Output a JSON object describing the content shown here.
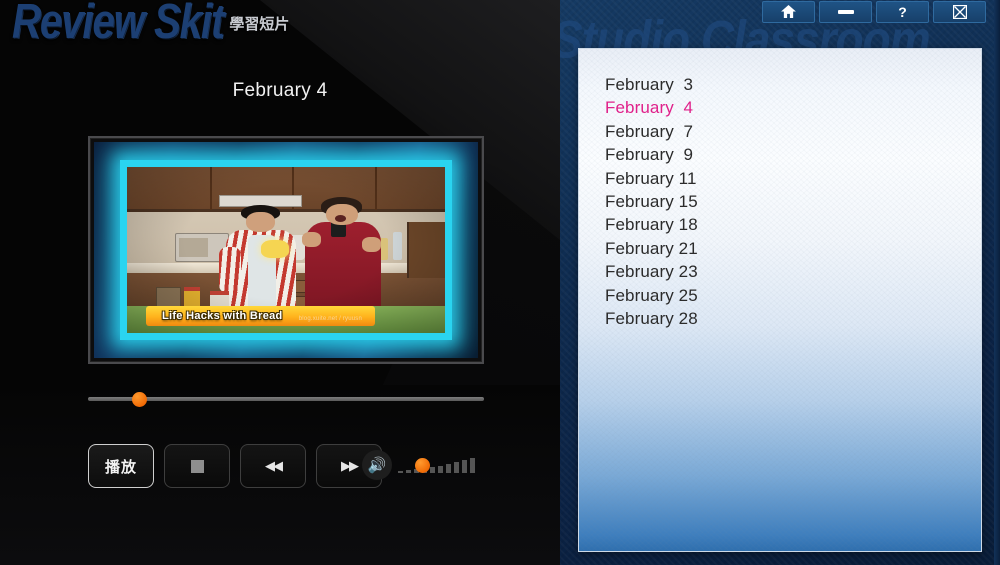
{
  "app": {
    "brand_main": "Review Skit",
    "brand_sub": "學習短片",
    "watermark": "Studio Classroom"
  },
  "titlebar": {
    "buttons": [
      {
        "name": "home",
        "glyph": "⌂",
        "label": "Home"
      },
      {
        "name": "minimize",
        "glyph": "—",
        "label": "Minimize"
      },
      {
        "name": "help",
        "glyph": "?",
        "label": "Help"
      },
      {
        "name": "close",
        "glyph": "☒",
        "label": "Close"
      }
    ]
  },
  "player": {
    "current_date": "February  4",
    "video_title": "Life Hacks with Bread",
    "video_watermark": "blog.xuite.net / ryuusn",
    "progress_percent": 13,
    "volume_percent": 18,
    "controls": [
      {
        "name": "play",
        "label": "播放",
        "icon": "",
        "active": true
      },
      {
        "name": "stop",
        "label": "",
        "icon": "stop-square",
        "active": false
      },
      {
        "name": "rewind",
        "label": "",
        "icon": "◀◀",
        "active": false
      },
      {
        "name": "forward",
        "label": "",
        "icon": "▶▶",
        "active": false
      }
    ],
    "volume_icon": "🔊"
  },
  "date_list": {
    "items": [
      {
        "label": "February  3",
        "selected": false
      },
      {
        "label": "February  4",
        "selected": true
      },
      {
        "label": "February  7",
        "selected": false
      },
      {
        "label": "February  9",
        "selected": false
      },
      {
        "label": "February 11",
        "selected": false
      },
      {
        "label": "February 15",
        "selected": false
      },
      {
        "label": "February 18",
        "selected": false
      },
      {
        "label": "February 21",
        "selected": false
      },
      {
        "label": "February 23",
        "selected": false
      },
      {
        "label": "February 25",
        "selected": false
      },
      {
        "label": "February 28",
        "selected": false
      }
    ]
  },
  "colors": {
    "accent_orange": "#f06a05",
    "selected_pink": "#e0218a",
    "brand_blue": "#1c3f73",
    "panel_navy": "#0f2d52",
    "glow_cyan": "#2ad4f0"
  }
}
